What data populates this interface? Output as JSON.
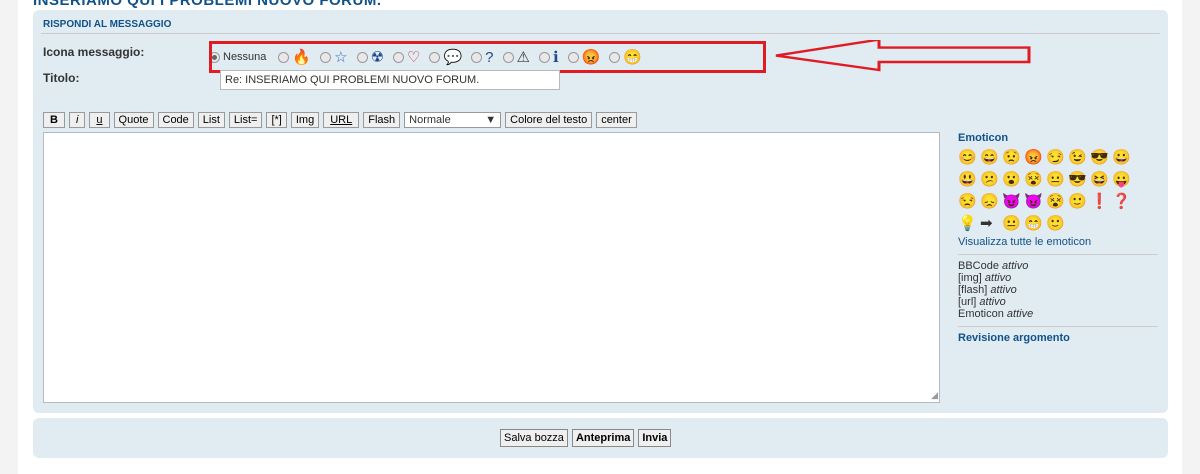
{
  "header": {
    "heading": "INSERIAMO QUI I PROBLEMI NUOVO FORUM."
  },
  "panel": {
    "title": "RISPONDI AL MESSAGGIO"
  },
  "form": {
    "icon_label": "Icona messaggio:",
    "title_label": "Titolo:",
    "title_value": "Re: INSERIAMO QUI PROBLEMI NUOVO FORUM.",
    "icons": [
      {
        "label": "Nessuna",
        "glyph": "",
        "color": "#333",
        "checked": true,
        "name": "none"
      },
      {
        "label": "",
        "glyph": "🔥",
        "color": "#e86a2c",
        "checked": false,
        "name": "fire-icon"
      },
      {
        "label": "",
        "glyph": "☆",
        "color": "#2a6ebb",
        "checked": false,
        "name": "star-icon"
      },
      {
        "label": "",
        "glyph": "☢",
        "color": "#1e4a8a",
        "checked": false,
        "name": "radioactive-icon"
      },
      {
        "label": "",
        "glyph": "♡",
        "color": "#d0213a",
        "checked": false,
        "name": "heart-icon"
      },
      {
        "label": "",
        "glyph": "💬",
        "color": "#2a6ebb",
        "checked": false,
        "name": "speech-bubble-icon"
      },
      {
        "label": "",
        "glyph": "?",
        "color": "#1e4a8a",
        "checked": false,
        "name": "question-icon"
      },
      {
        "label": "",
        "glyph": "⚠",
        "color": "#333",
        "checked": false,
        "name": "warning-icon"
      },
      {
        "label": "",
        "glyph": "ℹ",
        "color": "#1e4a8a",
        "checked": false,
        "name": "info-icon"
      },
      {
        "label": "",
        "glyph": "😡",
        "color": "#d0213a",
        "checked": false,
        "name": "mad-icon"
      },
      {
        "label": "",
        "glyph": "😁",
        "color": "#2a8a2a",
        "checked": false,
        "name": "grin-icon"
      }
    ]
  },
  "toolbar": {
    "buttons": [
      "B",
      "i",
      "u",
      "Quote",
      "Code",
      "List",
      "List=",
      "[*]",
      "Img",
      "URL",
      "Flash"
    ],
    "size_select": "Normale",
    "color_button": "Colore del testo",
    "center_button": "center"
  },
  "sidebar": {
    "emoticon_title": "Emoticon",
    "emoticons": [
      "😊",
      "😄",
      "😟",
      "😡",
      "😏",
      "😉",
      "😎",
      "😀",
      "😃",
      "😕",
      "😮",
      "😵",
      "😐",
      "😎",
      "😆",
      "😛",
      "😒",
      "😞",
      "😈",
      "😈",
      "😵",
      "🙂",
      "❗",
      "❓",
      "💡",
      "➡",
      "😐",
      "😁",
      "🙂"
    ],
    "view_all": "Visualizza tutte le emoticon",
    "bbcode": [
      {
        "name": "BBCode",
        "status": "attivo"
      },
      {
        "name": "[img]",
        "status": "attivo"
      },
      {
        "name": "[flash]",
        "status": "attivo"
      },
      {
        "name": "[url]",
        "status": "attivo"
      },
      {
        "name": "Emoticon",
        "status": "attive"
      }
    ],
    "review": "Revisione argomento"
  },
  "actions": {
    "save_draft": "Salva bozza",
    "preview": "Anteprima",
    "submit": "Invia"
  },
  "colors": {
    "accent": "#105289",
    "panel": "#e1ebf2",
    "highlight": "#e01b24"
  }
}
